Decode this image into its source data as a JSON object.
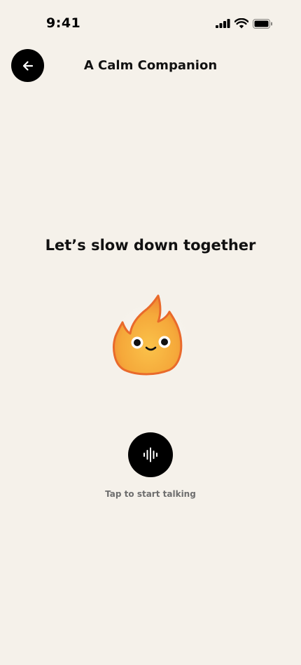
{
  "status_bar": {
    "time": "9:41",
    "icons": [
      "cellular-signal-icon",
      "wifi-icon",
      "battery-icon"
    ]
  },
  "header": {
    "back_icon": "arrow-left-icon",
    "title": "A Calm Companion"
  },
  "main": {
    "headline": "Let’s slow down together",
    "mascot": "flame-mascot",
    "mic_icon": "voice-waveform-icon",
    "hint": "Tap to start talking"
  },
  "colors": {
    "background": "#F5F1EA",
    "button": "#000000",
    "flame_fill": "#F4A93C",
    "flame_outline": "#E96A2B",
    "hint_text": "#6E6E6E"
  }
}
